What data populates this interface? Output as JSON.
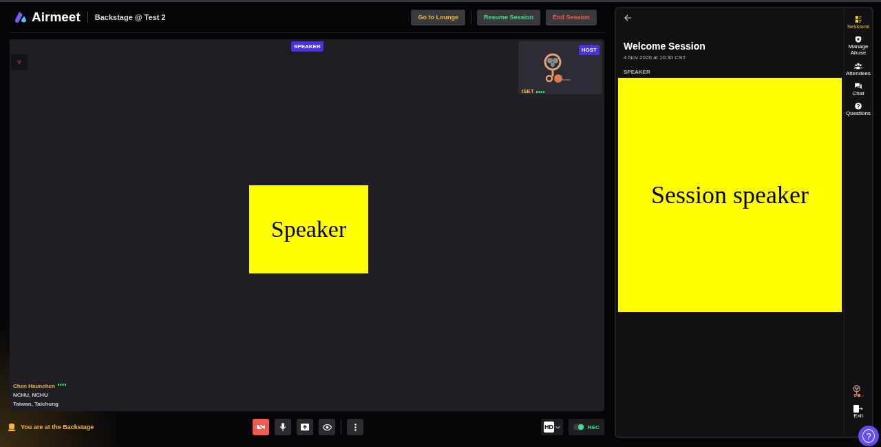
{
  "header": {
    "logo": "Airmeet",
    "event_title": "Backstage @ Test 2",
    "buttons": [
      {
        "label": "Go to Lounge",
        "kind": "lounge"
      },
      {
        "label": "Resume Session",
        "kind": "resume"
      },
      {
        "label": "End Session",
        "kind": "end"
      }
    ]
  },
  "stage": {
    "badge": "SPEAKER",
    "speaker_card": "Speaker",
    "host_tile": {
      "badge": "HOST",
      "name": "ISET"
    },
    "presenter": {
      "name": "Chen Haunchen",
      "organization": "NCHU, NCHU",
      "location": "Taiwan, Taichung"
    }
  },
  "bottom_bar": {
    "status": "You are at the Backstage",
    "camera_on": false,
    "quality": "HD",
    "recording": {
      "label": "REC",
      "on": true
    }
  },
  "session_panel": {
    "title": "Welcome Session",
    "date": "4 Nov 2020 at 10:30 CST",
    "section_label": "SPEAKER",
    "speaker_card": "Session speaker"
  },
  "side_nav": {
    "items": [
      {
        "label": "Sessions",
        "kind": "sessions",
        "selected": true
      },
      {
        "label": "Manage Abuse",
        "kind": "abuse",
        "selected": false
      },
      {
        "label": "Attendees",
        "kind": "attendees",
        "selected": false
      },
      {
        "label": "Chat",
        "kind": "chat",
        "selected": false
      },
      {
        "label": "Questions",
        "kind": "questions",
        "selected": false
      }
    ],
    "exit": "Exit",
    "help": "?"
  }
}
